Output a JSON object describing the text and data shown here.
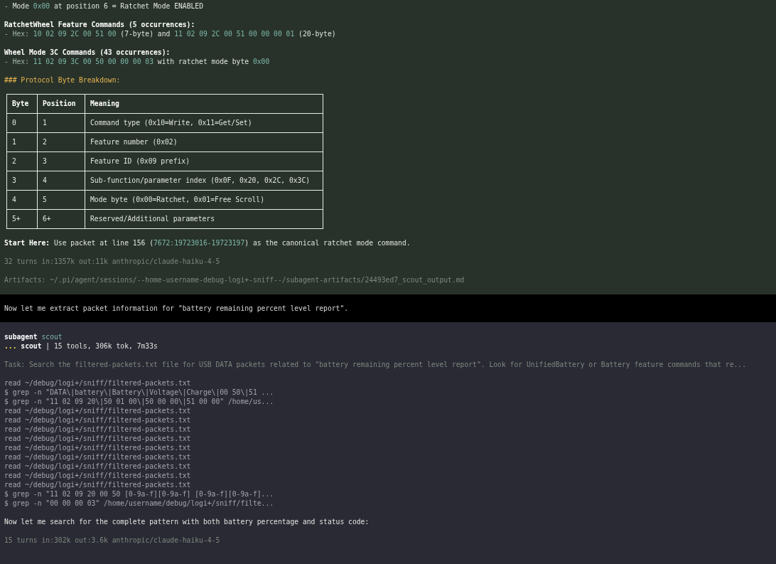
{
  "result_panel": {
    "blocks": [
      {
        "kind": "paragraph",
        "lines": [
          {
            "segments": [
              {
                "kind": "muted",
                "text": "- "
              },
              {
                "kind": "plain",
                "text": "Mode "
              },
              {
                "kind": "code",
                "text": "0x00"
              },
              {
                "kind": "plain",
                "text": " at position 6 = Ratchet Mode ENABLED"
              }
            ]
          }
        ]
      },
      {
        "kind": "paragraph",
        "lines": [
          {
            "segments": [
              {
                "kind": "bold",
                "text": "RatchetWheel Feature Commands (5 occurrences):"
              }
            ]
          },
          {
            "segments": [
              {
                "kind": "muted",
                "text": "- Hex: "
              },
              {
                "kind": "code",
                "text": "10 02 09 2C 00 51 00"
              },
              {
                "kind": "plain",
                "text": " (7-byte) and "
              },
              {
                "kind": "code",
                "text": "11 02 09 2C 00 51 00 00 00 01"
              },
              {
                "kind": "plain",
                "text": " (20-byte)"
              }
            ]
          }
        ]
      },
      {
        "kind": "paragraph",
        "lines": [
          {
            "segments": [
              {
                "kind": "bold",
                "text": "Wheel Mode 3C Commands (43 occurrences):"
              }
            ]
          },
          {
            "segments": [
              {
                "kind": "muted",
                "text": "- Hex: "
              },
              {
                "kind": "code",
                "text": "11 02 09 3C 00 50 00 00 00 03"
              },
              {
                "kind": "plain",
                "text": " with ratchet mode byte "
              },
              {
                "kind": "code",
                "text": "0x00"
              }
            ]
          }
        ]
      },
      {
        "kind": "paragraph",
        "lines": [
          {
            "segments": [
              {
                "kind": "heading",
                "text": "### Protocol Byte Breakdown:"
              }
            ]
          }
        ]
      },
      {
        "kind": "table",
        "columns": [
          "Byte",
          "Position",
          "Meaning"
        ],
        "rows": [
          [
            "0",
            "1",
            "Command type (0x10=Write, 0x11=Get/Set)"
          ],
          [
            "1",
            "2",
            "Feature number (0x02)"
          ],
          [
            "2",
            "3",
            "Feature ID (0x09 prefix)"
          ],
          [
            "3",
            "4",
            "Sub-function/parameter index (0x0F, 0x20, 0x2C, 0x3C)"
          ],
          [
            "4",
            "5",
            "Mode byte (0x00=Ratchet, 0x01=Free Scroll)"
          ],
          [
            "5+",
            "6+",
            "Reserved/Additional parameters"
          ]
        ]
      },
      {
        "kind": "paragraph",
        "lines": [
          {
            "segments": [
              {
                "kind": "bold",
                "text": "Start Here:"
              },
              {
                "kind": "plain",
                "text": " Use packet at line 156 ("
              },
              {
                "kind": "code",
                "text": "7672:19723016-19723197"
              },
              {
                "kind": "plain",
                "text": ") as the canonical ratchet mode command."
              }
            ]
          }
        ]
      },
      {
        "kind": "paragraph",
        "lines": [
          {
            "segments": [
              {
                "kind": "dim",
                "text": "32 turns in:1357k out:11k anthropic/claude-haiku-4-5"
              }
            ]
          }
        ]
      },
      {
        "kind": "paragraph",
        "lines": [
          {
            "segments": [
              {
                "kind": "dim",
                "text": "Artifacts: ~/.pi/agent/sessions/--home-username-debug-logi+-sniff--/subagent-artifacts/24493ed7_scout_output.md"
              }
            ]
          }
        ]
      }
    ]
  },
  "message": {
    "text": "Now let me extract packet information for \"battery remaining percent level report\"."
  },
  "subagent_panel": {
    "blocks": [
      {
        "kind": "paragraph",
        "lines": [
          {
            "segments": [
              {
                "kind": "bold",
                "text": "subagent"
              },
              {
                "kind": "code",
                "text": " scout"
              }
            ]
          },
          {
            "segments": [
              {
                "kind": "accent",
                "text": "..."
              },
              {
                "kind": "bold",
                "text": " scout"
              },
              {
                "kind": "plain",
                "text": " | 15 tools, 306k tok, 7m33s"
              }
            ]
          }
        ]
      },
      {
        "kind": "paragraph",
        "lines": [
          {
            "segments": [
              {
                "kind": "dim",
                "text": "Task: Search the filtered-packets.txt file for USB DATA packets related to \"battery remaining percent level report\". Look for UnifiedBattery or Battery feature commands that re..."
              }
            ]
          }
        ]
      },
      {
        "kind": "paragraph",
        "lines": [
          {
            "segments": [
              {
                "kind": "command",
                "text": "read ~/debug/logi+/sniff/filtered-packets.txt"
              }
            ]
          },
          {
            "segments": [
              {
                "kind": "command",
                "text": "$ grep -n \"DATA\\|battery\\|Battery\\|Voltage\\|Charge\\|00 50\\|51 ..."
              }
            ]
          },
          {
            "segments": [
              {
                "kind": "command",
                "text": "$ grep -n \"11 02 09 20\\|50 01 00\\|50 00 00\\|51 00 00\" /home/us..."
              }
            ]
          },
          {
            "segments": [
              {
                "kind": "command",
                "text": "read ~/debug/logi+/sniff/filtered-packets.txt"
              }
            ]
          },
          {
            "segments": [
              {
                "kind": "command",
                "text": "read ~/debug/logi+/sniff/filtered-packets.txt"
              }
            ]
          },
          {
            "segments": [
              {
                "kind": "command",
                "text": "read ~/debug/logi+/sniff/filtered-packets.txt"
              }
            ]
          },
          {
            "segments": [
              {
                "kind": "command",
                "text": "read ~/debug/logi+/sniff/filtered-packets.txt"
              }
            ]
          },
          {
            "segments": [
              {
                "kind": "command",
                "text": "read ~/debug/logi+/sniff/filtered-packets.txt"
              }
            ]
          },
          {
            "segments": [
              {
                "kind": "command",
                "text": "read ~/debug/logi+/sniff/filtered-packets.txt"
              }
            ]
          },
          {
            "segments": [
              {
                "kind": "command",
                "text": "read ~/debug/logi+/sniff/filtered-packets.txt"
              }
            ]
          },
          {
            "segments": [
              {
                "kind": "command",
                "text": "read ~/debug/logi+/sniff/filtered-packets.txt"
              }
            ]
          },
          {
            "segments": [
              {
                "kind": "command",
                "text": "read ~/debug/logi+/sniff/filtered-packets.txt"
              }
            ]
          },
          {
            "segments": [
              {
                "kind": "command",
                "text": "$ grep -n \"11 02 09 20 00 50 [0-9a-f][0-9a-f] [0-9a-f][0-9a-f]..."
              }
            ]
          },
          {
            "segments": [
              {
                "kind": "command",
                "text": "$ grep -n \"00 00 00 03\" /home/username/debug/logi+/sniff/filte..."
              }
            ]
          }
        ]
      },
      {
        "kind": "paragraph",
        "lines": [
          {
            "segments": [
              {
                "kind": "plain",
                "text": "Now let me search for the complete pattern with both battery percentage and status code:"
              }
            ]
          }
        ]
      },
      {
        "kind": "paragraph",
        "lines": [
          {
            "segments": [
              {
                "kind": "dim",
                "text": "15 turns in:302k out:3.6k anthropic/claude-haiku-4-5"
              }
            ]
          }
        ]
      }
    ]
  }
}
